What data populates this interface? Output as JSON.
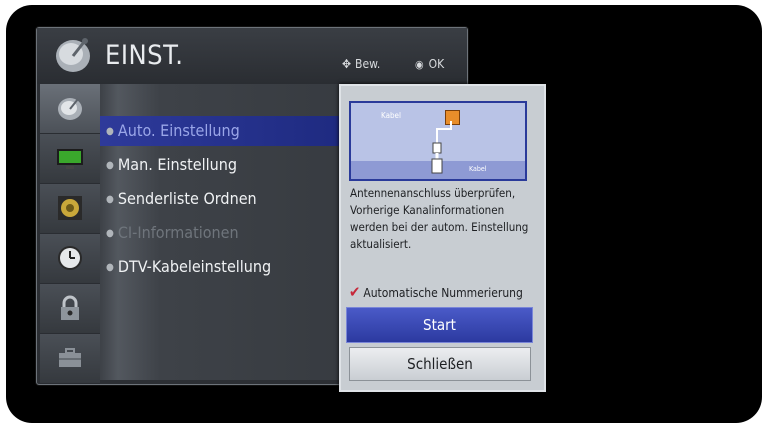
{
  "header": {
    "title": "EINST.",
    "hint_move_label": "Bew.",
    "hint_ok_label": "OK"
  },
  "categories": [
    {
      "icon": "satellite-dish-icon",
      "selected": true
    },
    {
      "icon": "monitor-icon",
      "selected": false
    },
    {
      "icon": "speaker-icon",
      "selected": false
    },
    {
      "icon": "clock-icon",
      "selected": false
    },
    {
      "icon": "lock-icon",
      "selected": false
    },
    {
      "icon": "toolbox-icon",
      "selected": false
    }
  ],
  "menu_items": [
    {
      "label": "Auto. Einstellung",
      "selected": true,
      "enabled": true
    },
    {
      "label": "Man. Einstellung",
      "selected": false,
      "enabled": true
    },
    {
      "label": "Senderliste Ordnen",
      "selected": false,
      "enabled": true
    },
    {
      "label": "CI-Informationen",
      "selected": false,
      "enabled": false
    },
    {
      "label": "DTV-Kabeleinstellung",
      "selected": false,
      "enabled": true
    }
  ],
  "popup": {
    "illustration": {
      "label_top": "Kabel",
      "label_bottom": "Kabel"
    },
    "description": "Antennenanschluss überprüfen, Vorherige Kanalinformationen werden bei der autom. Einstellung aktualisiert.",
    "auto_numbering_label": "Automatische Nummerierung",
    "auto_numbering_checked": true,
    "start_label": "Start",
    "close_label": "Schließen"
  },
  "colors": {
    "selection_blue": "#2e3a9a",
    "start_button": "#3a4ab8",
    "checkmark": "#c6283a",
    "connector_orange": "#e88d2a"
  }
}
